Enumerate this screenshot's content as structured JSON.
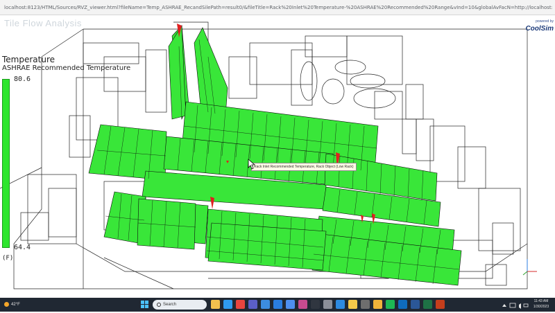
{
  "browser": {
    "url": "localhost:8123/HTML/Sources/RVZ_viewer.html?fileName=Temp_ASHRAE_RecandSilePath=result0/&fileTitle=Rack%20Inlet%20Temperature-%20ASHRAE%20Recommended%20Range&vInd=10&globalAvFacN=http://localhost:8123/Demo%20Data%20Center%20RC%20RTR%20Dashboard_44804/"
  },
  "viewport": {
    "ghost_title": "Tile Flow Analysis",
    "cursor_tooltip": "Rack Inlet Recommended Temperature, Rack Object (Low Rack)"
  },
  "legend": {
    "title": "Temperature",
    "subtitle": "ASHRAE Recommended Temperature",
    "max": "80.6",
    "min": "64.4",
    "unit": "(F)",
    "color": "#2ee62e"
  },
  "logo": {
    "top_text": "powered by",
    "name": "CoolSim"
  },
  "taskbar": {
    "weather": "42°F",
    "search_label": "Search",
    "time": "11:43 AM",
    "date": "1/30/2023",
    "apps": [
      "file-explorer-icon",
      "edge-icon",
      "chrome-icon",
      "teams-icon",
      "store-icon",
      "mail-icon",
      "calendar-icon",
      "photos-icon",
      "terminal-icon",
      "settings-icon",
      "vscode-icon",
      "notes-icon",
      "camera-icon",
      "folder-icon",
      "spotify-icon",
      "outlook-icon",
      "word-icon",
      "excel-icon",
      "powerpoint-icon"
    ]
  },
  "colors": {
    "rack": "#39e639",
    "rack_edge": "#0a0a0a",
    "hot_spot": "#e02020",
    "wireframe": "#1e1e1e"
  }
}
